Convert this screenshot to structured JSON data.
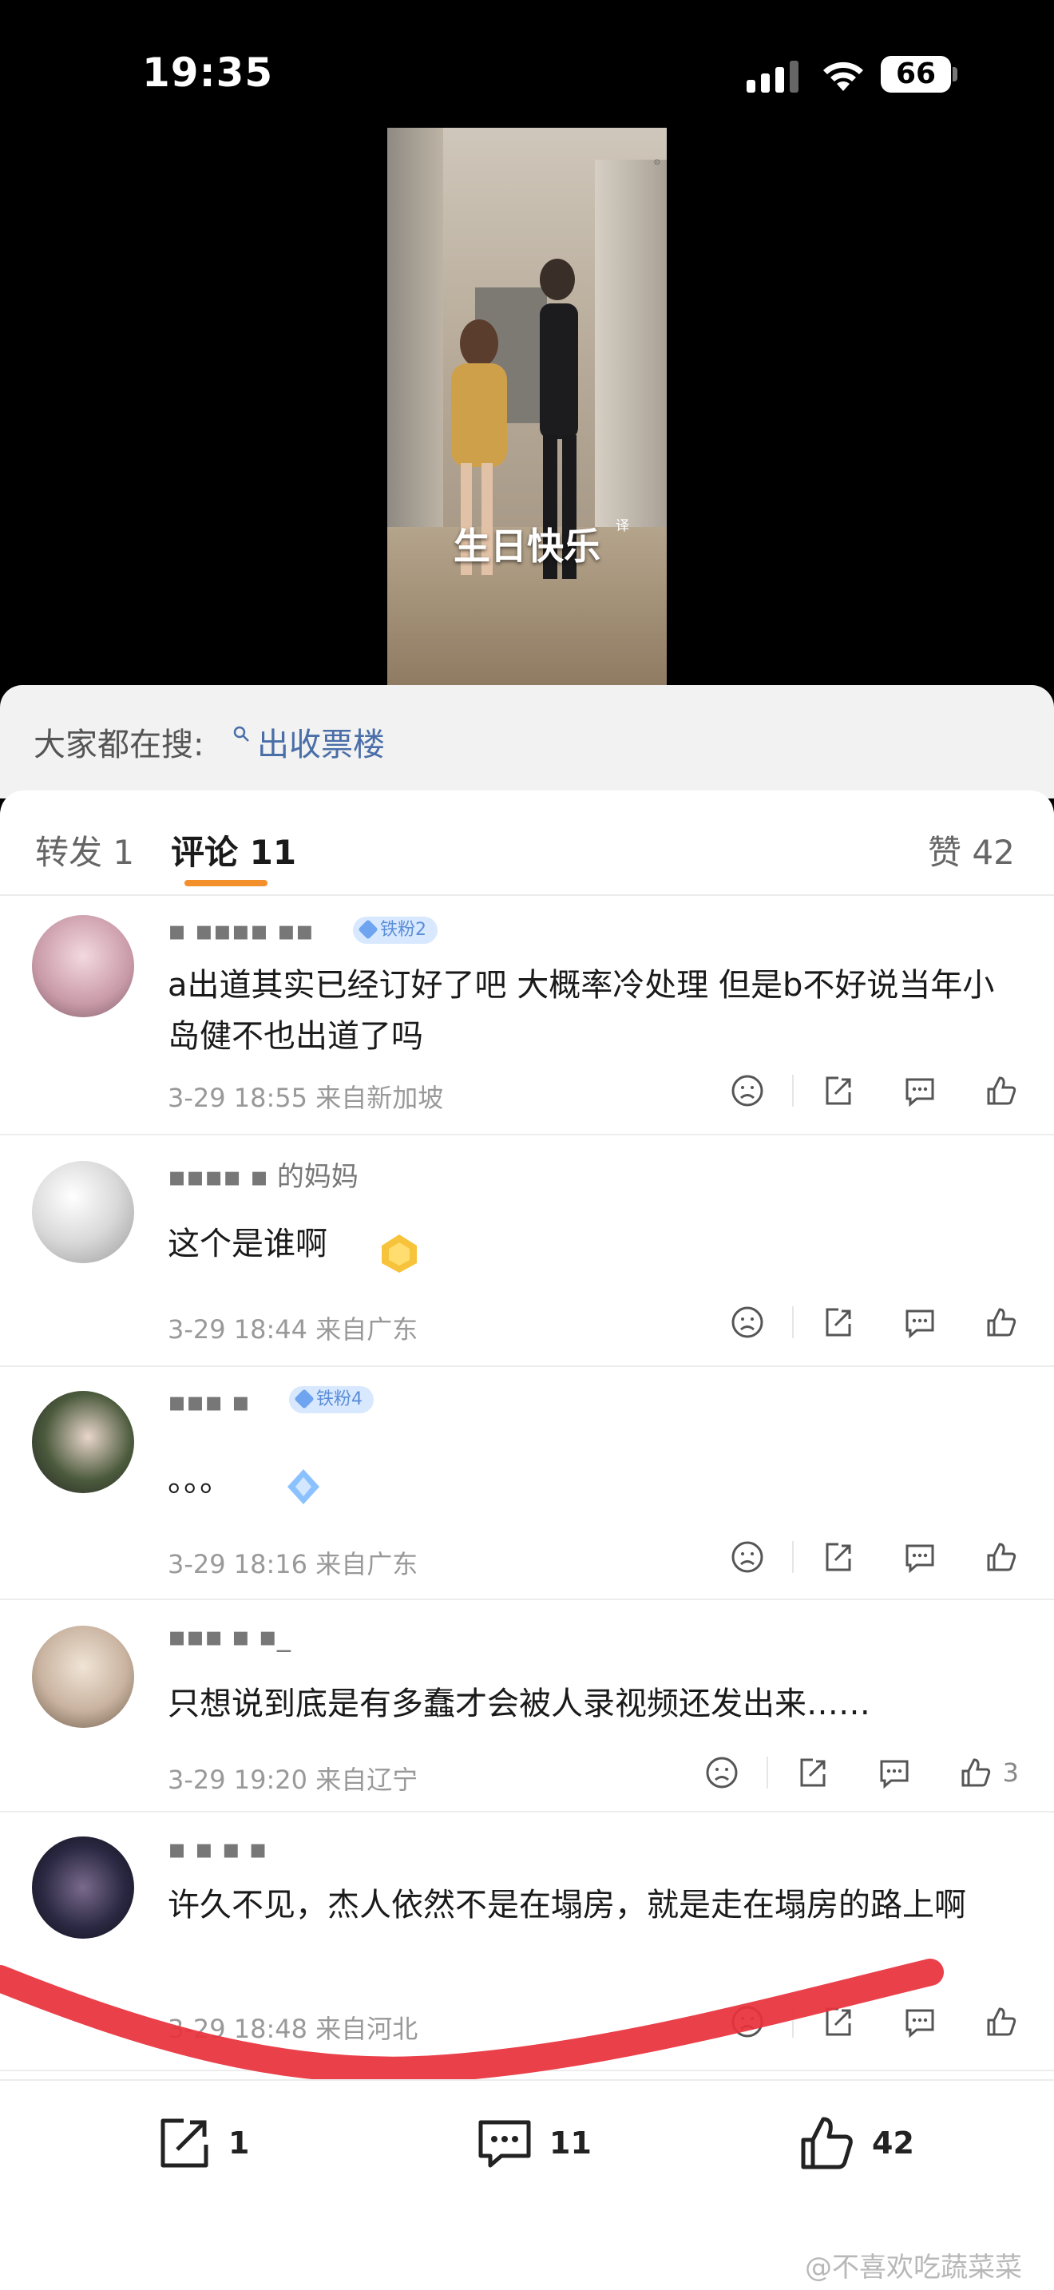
{
  "status_bar": {
    "time": "19:35",
    "battery": "66"
  },
  "video": {
    "subtitle": "生日快乐",
    "translate_mark": "译"
  },
  "hot_search": {
    "label": "大家都在搜:",
    "keyword": "出收票楼"
  },
  "tabs": {
    "repost": "转发 1",
    "comments": "评论 11",
    "likes": "赞 42"
  },
  "comments": [
    {
      "badge": "铁粉2",
      "text": "a出道其实已经订好了吧 大概率冷处理 但是b不好说当年小岛健不也出道了吗",
      "meta": "3-29 18:55  来自新加坡",
      "like_count": ""
    },
    {
      "name_partial": "的妈妈",
      "text": "这个是谁啊",
      "meta": "3-29 18:44  来自广东",
      "like_count": ""
    },
    {
      "badge": "铁粉4",
      "text": "。。。",
      "meta": "3-29 18:16  来自广东",
      "like_count": ""
    },
    {
      "text": "只想说到底是有多蠢才会被人录视频还发出来……",
      "meta": "3-29 19:20  来自辽宁",
      "like_count": "3"
    },
    {
      "text": "许久不见，杰人依然不是在塌房，就是走在塌房的路上啊",
      "meta": "3-29 18:48  来自河北",
      "like_count": ""
    }
  ],
  "bottom_bar": {
    "repost_count": "1",
    "comment_count": "11",
    "like_count": "42"
  },
  "watermark": "@不喜欢吃蔬菜菜",
  "colors": {
    "accent": "#f4902c",
    "link": "#4a6ea8",
    "scribble": "#e8323c"
  }
}
